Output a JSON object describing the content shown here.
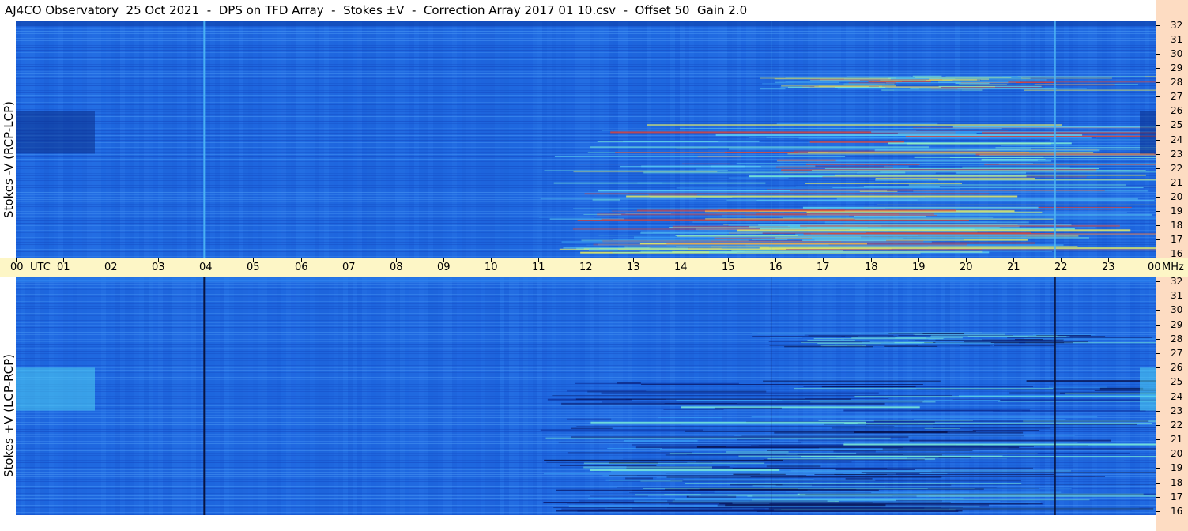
{
  "title": "AJ4CO Observatory  25 Oct 2021  -  DPS on TFD Array  -  Stokes ±V  -  Correction Array 2017 01 10.csv  -  Offset 50  Gain 2.0",
  "chart_data": [
    {
      "type": "heatmap",
      "ylabel": "Stokes -V (RCP-LCP)",
      "x_ticks": [
        "00",
        "01",
        "02",
        "03",
        "04",
        "05",
        "06",
        "07",
        "08",
        "09",
        "10",
        "11",
        "12",
        "13",
        "14",
        "15",
        "16",
        "17",
        "18",
        "19",
        "20",
        "21",
        "22",
        "23",
        "00"
      ],
      "x_unit": "UTC",
      "y_unit": "MHz",
      "y_ticks": [
        16,
        17,
        18,
        19,
        20,
        21,
        22,
        23,
        24,
        25,
        26,
        27,
        28,
        29,
        30,
        31,
        32
      ],
      "ylim": [
        16,
        32
      ],
      "xlim_hours": [
        0,
        24
      ],
      "colormap": [
        "#0a1a6a",
        "#1148c4",
        "#1f6fe8",
        "#3aa0f5",
        "#7ef2d8",
        "#f3f55a",
        "#e9402a"
      ],
      "background_color": "#1f68e0"
    },
    {
      "type": "heatmap",
      "ylabel": "Stokes +V (LCP-RCP)",
      "x_ticks": [
        "00",
        "01",
        "02",
        "03",
        "04",
        "05",
        "06",
        "07",
        "08",
        "09",
        "10",
        "11",
        "12",
        "13",
        "14",
        "15",
        "16",
        "17",
        "18",
        "19",
        "20",
        "21",
        "22",
        "23",
        "00"
      ],
      "x_unit": "UTC",
      "y_unit": "MHz",
      "y_ticks": [
        16,
        17,
        18,
        19,
        20,
        21,
        22,
        23,
        24,
        25,
        26,
        27,
        28,
        29,
        30,
        31,
        32
      ],
      "ylim": [
        16,
        32
      ],
      "xlim_hours": [
        0,
        24
      ],
      "colormap": [
        "#050a40",
        "#0c2f9a",
        "#1f6fe8",
        "#3aa0f5",
        "#7ef2d8",
        "#f3f55a"
      ],
      "background_color": "#1f68e0"
    }
  ]
}
